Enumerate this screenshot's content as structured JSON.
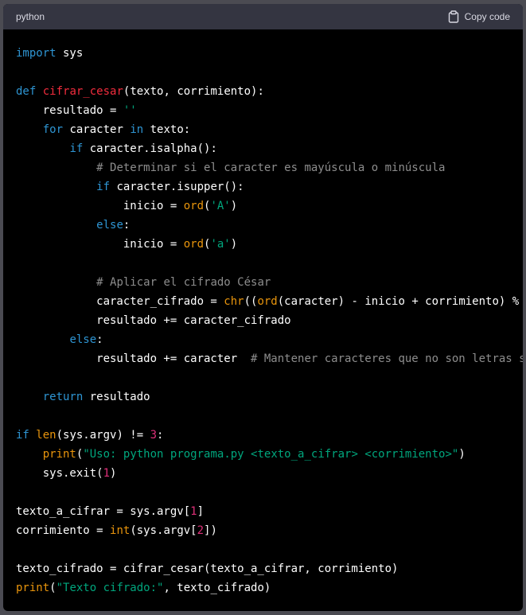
{
  "header": {
    "language": "python",
    "copy_label": "Copy code"
  },
  "colors": {
    "keyword": "#2e95d3",
    "function_name": "#f22c3d",
    "string": "#00a67d",
    "number": "#df3079",
    "builtin": "#e9950c",
    "comment": "#8d8d8d",
    "text": "#ffffff",
    "header_bg": "#343541",
    "code_bg": "#000000"
  },
  "code": {
    "lines": [
      [
        [
          "kw",
          "import"
        ],
        [
          "plain",
          " sys"
        ]
      ],
      [],
      [
        [
          "kw",
          "def"
        ],
        [
          "plain",
          " "
        ],
        [
          "fn",
          "cifrar_cesar"
        ],
        [
          "plain",
          "(texto, corrimiento):"
        ]
      ],
      [
        [
          "plain",
          "    resultado = "
        ],
        [
          "str",
          "''"
        ]
      ],
      [
        [
          "plain",
          "    "
        ],
        [
          "kw",
          "for"
        ],
        [
          "plain",
          " caracter "
        ],
        [
          "kw",
          "in"
        ],
        [
          "plain",
          " texto:"
        ]
      ],
      [
        [
          "plain",
          "        "
        ],
        [
          "kw",
          "if"
        ],
        [
          "plain",
          " caracter.isalpha():"
        ]
      ],
      [
        [
          "plain",
          "            "
        ],
        [
          "cm",
          "# Determinar si el caracter es mayúscula o minúscula"
        ]
      ],
      [
        [
          "plain",
          "            "
        ],
        [
          "kw",
          "if"
        ],
        [
          "plain",
          " caracter.isupper():"
        ]
      ],
      [
        [
          "plain",
          "                inicio = "
        ],
        [
          "bi",
          "ord"
        ],
        [
          "plain",
          "("
        ],
        [
          "str",
          "'A'"
        ],
        [
          "plain",
          ")"
        ]
      ],
      [
        [
          "plain",
          "            "
        ],
        [
          "kw",
          "else"
        ],
        [
          "plain",
          ":"
        ]
      ],
      [
        [
          "plain",
          "                inicio = "
        ],
        [
          "bi",
          "ord"
        ],
        [
          "plain",
          "("
        ],
        [
          "str",
          "'a'"
        ],
        [
          "plain",
          ")"
        ]
      ],
      [],
      [
        [
          "plain",
          "            "
        ],
        [
          "cm",
          "# Aplicar el cifrado César"
        ]
      ],
      [
        [
          "plain",
          "            caracter_cifrado = "
        ],
        [
          "bi",
          "chr"
        ],
        [
          "plain",
          "(("
        ],
        [
          "bi",
          "ord"
        ],
        [
          "plain",
          "(caracter) - inicio + corrimiento) % "
        ]
      ],
      [
        [
          "plain",
          "            resultado += caracter_cifrado"
        ]
      ],
      [
        [
          "plain",
          "        "
        ],
        [
          "kw",
          "else"
        ],
        [
          "plain",
          ":"
        ]
      ],
      [
        [
          "plain",
          "            resultado += caracter  "
        ],
        [
          "cm",
          "# Mantener caracteres que no son letras s"
        ]
      ],
      [],
      [
        [
          "plain",
          "    "
        ],
        [
          "kw",
          "return"
        ],
        [
          "plain",
          " resultado"
        ]
      ],
      [],
      [
        [
          "kw",
          "if"
        ],
        [
          "plain",
          " "
        ],
        [
          "bi",
          "len"
        ],
        [
          "plain",
          "(sys.argv) != "
        ],
        [
          "num",
          "3"
        ],
        [
          "plain",
          ":"
        ]
      ],
      [
        [
          "plain",
          "    "
        ],
        [
          "bi",
          "print"
        ],
        [
          "plain",
          "("
        ],
        [
          "str",
          "\"Uso: python programa.py <texto_a_cifrar> <corrimiento>\""
        ],
        [
          "plain",
          ")"
        ]
      ],
      [
        [
          "plain",
          "    sys.exit("
        ],
        [
          "num",
          "1"
        ],
        [
          "plain",
          ")"
        ]
      ],
      [],
      [
        [
          "plain",
          "texto_a_cifrar = sys.argv["
        ],
        [
          "num",
          "1"
        ],
        [
          "plain",
          "]"
        ]
      ],
      [
        [
          "plain",
          "corrimiento = "
        ],
        [
          "bi",
          "int"
        ],
        [
          "plain",
          "(sys.argv["
        ],
        [
          "num",
          "2"
        ],
        [
          "plain",
          "])"
        ]
      ],
      [],
      [
        [
          "plain",
          "texto_cifrado = cifrar_cesar(texto_a_cifrar, corrimiento)"
        ]
      ],
      [
        [
          "bi",
          "print"
        ],
        [
          "plain",
          "("
        ],
        [
          "str",
          "\"Texto cifrado:\""
        ],
        [
          "plain",
          ", texto_cifrado)"
        ]
      ]
    ]
  }
}
